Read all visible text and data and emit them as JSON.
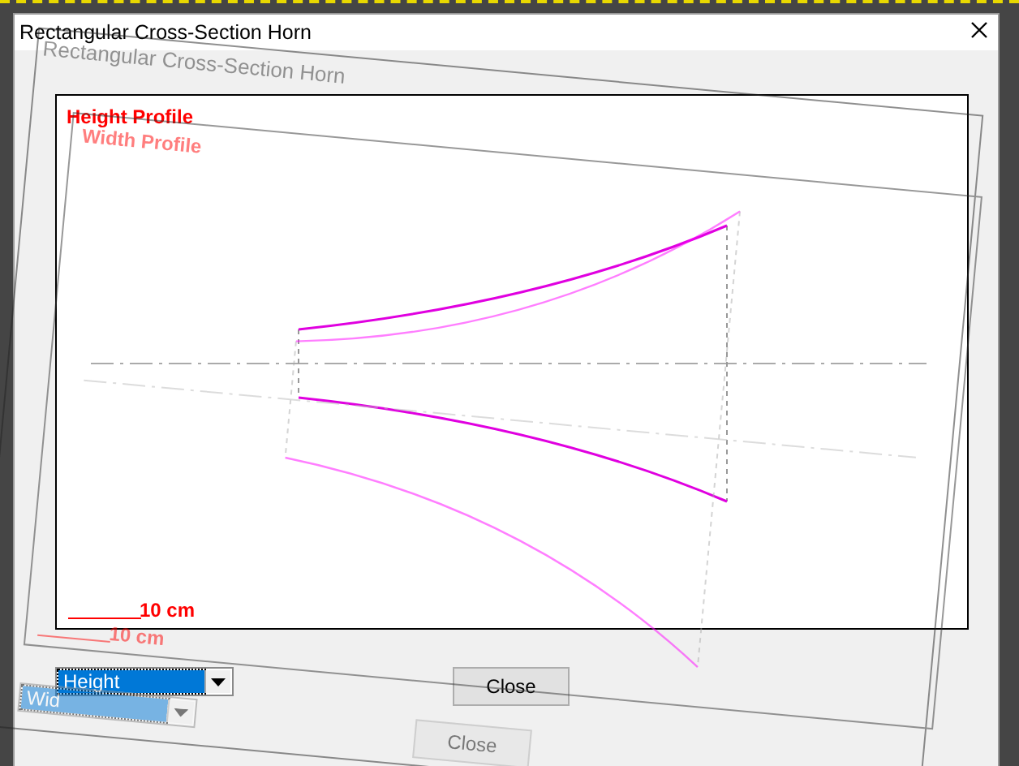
{
  "window": {
    "title": "Rectangular Cross-Section Horn"
  },
  "plot": {
    "label": "Height Profile",
    "scale_label": "10 cm"
  },
  "profile_select": {
    "value": "Height"
  },
  "buttons": [
    {
      "label": "Close"
    }
  ],
  "ghost_window": {
    "title": "Rectangular Cross-Section Horn",
    "plot": {
      "label": "Width Profile",
      "scale_label": "10 cm"
    },
    "profile_select": {
      "value": "Wid"
    },
    "buttons": [
      {
        "label": "Close"
      }
    ]
  }
}
